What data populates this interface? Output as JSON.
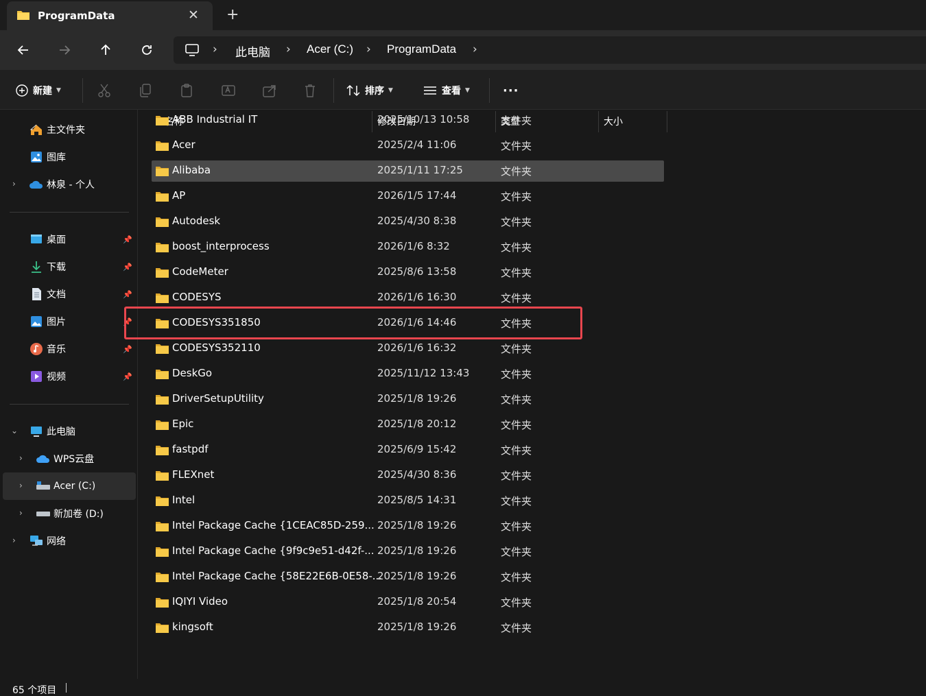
{
  "tab": {
    "title": "ProgramData",
    "close": "✕",
    "new": "+"
  },
  "address": {
    "crumbs": [
      "此电脑",
      "Acer (C:)",
      "ProgramData"
    ]
  },
  "commands": {
    "new_label": "新建",
    "sort_label": "排序",
    "view_label": "查看",
    "more_label": "···"
  },
  "sidebar": {
    "quick": [
      {
        "label": "主文件夹",
        "icon": "home-icon"
      },
      {
        "label": "图库",
        "icon": "gallery-icon"
      },
      {
        "label": "林泉 - 个人",
        "icon": "onedrive-icon"
      }
    ],
    "pinned": [
      {
        "label": "桌面",
        "icon": "desktop-icon"
      },
      {
        "label": "下载",
        "icon": "download-icon"
      },
      {
        "label": "文档",
        "icon": "documents-icon"
      },
      {
        "label": "图片",
        "icon": "pictures-icon"
      },
      {
        "label": "音乐",
        "icon": "music-icon"
      },
      {
        "label": "视频",
        "icon": "videos-icon"
      }
    ],
    "this_pc": "此电脑",
    "drives": [
      {
        "label": "WPS云盘",
        "icon": "wps-cloud-icon"
      },
      {
        "label": "Acer (C:)",
        "icon": "drive-c-icon"
      },
      {
        "label": "新加卷 (D:)",
        "icon": "drive-d-icon"
      }
    ],
    "network": "网络"
  },
  "columns": {
    "name": "名称",
    "date": "修改日期",
    "type": "类型",
    "size": "大小"
  },
  "files": [
    {
      "name": "ABB Industrial IT",
      "date": "2025/10/13 10:58",
      "type": "文件夹"
    },
    {
      "name": "Acer",
      "date": "2025/2/4 11:06",
      "type": "文件夹"
    },
    {
      "name": "Alibaba",
      "date": "2025/1/11 17:25",
      "type": "文件夹"
    },
    {
      "name": "AP",
      "date": "2026/1/5 17:44",
      "type": "文件夹"
    },
    {
      "name": "Autodesk",
      "date": "2025/4/30 8:38",
      "type": "文件夹"
    },
    {
      "name": "boost_interprocess",
      "date": "2026/1/6 8:32",
      "type": "文件夹"
    },
    {
      "name": "CodeMeter",
      "date": "2025/8/6 13:58",
      "type": "文件夹"
    },
    {
      "name": "CODESYS",
      "date": "2026/1/6 16:30",
      "type": "文件夹"
    },
    {
      "name": "CODESYS351850",
      "date": "2026/1/6 14:46",
      "type": "文件夹"
    },
    {
      "name": "CODESYS352110",
      "date": "2026/1/6 16:32",
      "type": "文件夹"
    },
    {
      "name": "DeskGo",
      "date": "2025/11/12 13:43",
      "type": "文件夹"
    },
    {
      "name": "DriverSetupUtility",
      "date": "2025/1/8 19:26",
      "type": "文件夹"
    },
    {
      "name": "Epic",
      "date": "2025/1/8 20:12",
      "type": "文件夹"
    },
    {
      "name": "fastpdf",
      "date": "2025/6/9 15:42",
      "type": "文件夹"
    },
    {
      "name": "FLEXnet",
      "date": "2025/4/30 8:36",
      "type": "文件夹"
    },
    {
      "name": "Intel",
      "date": "2025/8/5 14:31",
      "type": "文件夹"
    },
    {
      "name": "Intel Package Cache {1CEAC85D-259...",
      "date": "2025/1/8 19:26",
      "type": "文件夹"
    },
    {
      "name": "Intel Package Cache {9f9c9e51-d42f-...",
      "date": "2025/1/8 19:26",
      "type": "文件夹"
    },
    {
      "name": "Intel Package Cache {58E22E6B-0E58-...",
      "date": "2025/1/8 19:26",
      "type": "文件夹"
    },
    {
      "name": "IQIYI Video",
      "date": "2025/1/8 20:54",
      "type": "文件夹"
    },
    {
      "name": "kingsoft",
      "date": "2025/1/8 19:26",
      "type": "文件夹"
    }
  ],
  "selected_file": "Alibaba",
  "highlighted_file": "CODESYS",
  "status": {
    "count": "65 个项目"
  },
  "colors": {
    "folder": "#f4c542",
    "highlight": "#e8464e",
    "selected_row": "#4a4a4a"
  }
}
